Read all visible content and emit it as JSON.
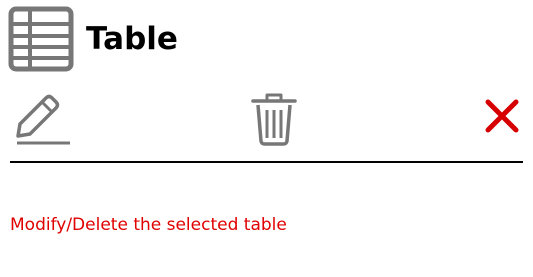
{
  "header": {
    "icon": "table-icon",
    "title": "Table"
  },
  "toolbar": {
    "edit_icon": "pencil-icon",
    "delete_icon": "trash-icon",
    "close_icon": "close-icon",
    "close_color": "#d60000"
  },
  "status": {
    "message": "Modify/Delete the selected table",
    "color": "#e00000"
  }
}
